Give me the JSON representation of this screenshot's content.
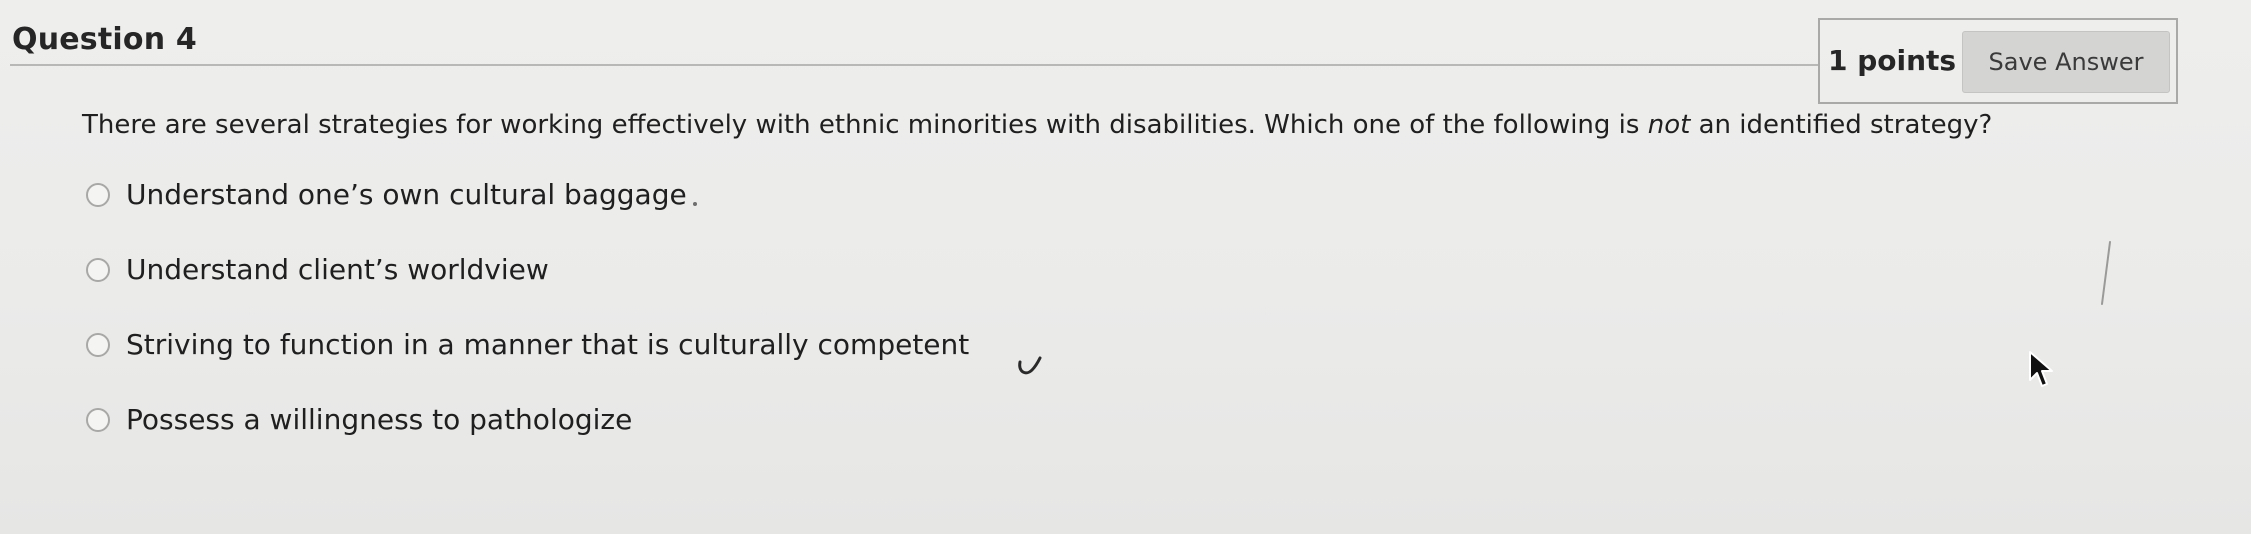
{
  "question": {
    "title": "Question 4",
    "points": "1 points",
    "save_label": "Save Answer",
    "text_before": "There are several strategies for working effectively with ethnic minorities with disabilities. Which one of the following is ",
    "text_emphasis": "not",
    "text_after": " an identified strategy?"
  },
  "options": [
    {
      "label": "Understand one’s own cultural baggage"
    },
    {
      "label": "Understand client’s worldview"
    },
    {
      "label": "Striving to function in a manner that is culturally competent"
    },
    {
      "label": "Possess a willingness to pathologize"
    }
  ],
  "colors": {
    "background": "#ebebea",
    "button_background": "#d4d4d3",
    "rule": "#b8b8b6",
    "text": "#1f1f1f"
  },
  "icons": {
    "radio": "radio-unselected-icon",
    "cursor": "mouse-pointer-icon"
  }
}
